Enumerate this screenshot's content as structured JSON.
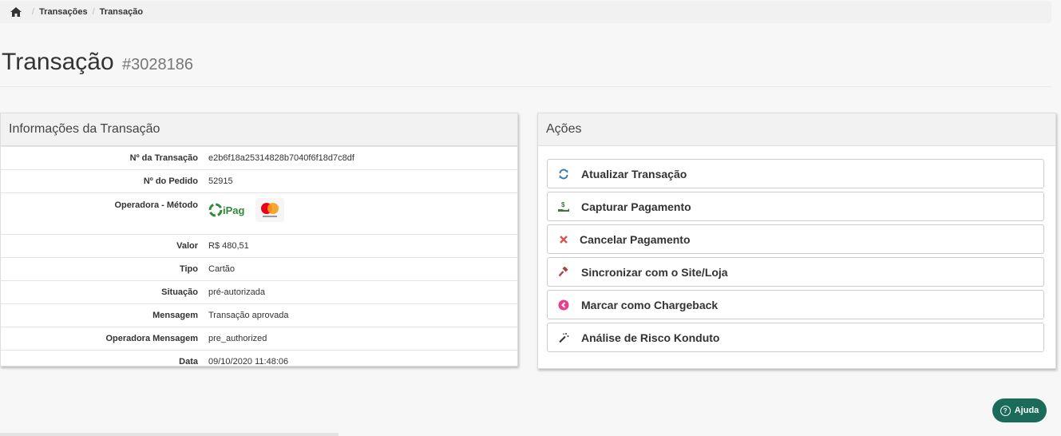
{
  "breadcrumb": {
    "home_icon": "home-icon",
    "items": [
      "Transações",
      "Transação"
    ]
  },
  "header": {
    "title": "Transação",
    "id": "#3028186"
  },
  "info_panel": {
    "title": "Informações da Transação",
    "rows": {
      "transaction_no": {
        "label": "Nº da Transação",
        "value": "e2b6f18a25314828b7040f6f18d7c8df"
      },
      "order_no": {
        "label": "Nº do Pedido",
        "value": "52915"
      },
      "operator_method": {
        "label": "Operadora - Método",
        "logos": [
          "iPag",
          "mastercard"
        ]
      },
      "amount": {
        "label": "Valor",
        "value": "R$ 480,51"
      },
      "type": {
        "label": "Tipo",
        "value": "Cartão"
      },
      "status": {
        "label": "Situação",
        "value": "pré-autorizada",
        "color": "#f0ad4e"
      },
      "message": {
        "label": "Mensagem",
        "value": "Transação aprovada"
      },
      "operator_message": {
        "label": "Operadora Mensagem",
        "value": "pre_authorized"
      },
      "date": {
        "label": "Data",
        "value": "09/10/2020 11:48:06"
      }
    }
  },
  "actions_panel": {
    "title": "Ações",
    "buttons": [
      {
        "label": "Atualizar Transação",
        "icon": "refresh-icon",
        "color": "#337ab7"
      },
      {
        "label": "Capturar Pagamento",
        "icon": "capture-money-icon",
        "color": "#3c763d"
      },
      {
        "label": "Cancelar Pagamento",
        "icon": "close-icon",
        "color": "#d9534f"
      },
      {
        "label": "Sincronizar com o Site/Loja",
        "icon": "gavel-icon",
        "color": "#a94442"
      },
      {
        "label": "Marcar como Chargeback",
        "icon": "chevron-circle-left-icon",
        "color": "#e83e8c"
      },
      {
        "label": "Análise de Risco Konduto",
        "icon": "magic-wand-icon",
        "color": "#333333"
      }
    ]
  },
  "help": {
    "label": "Ajuda",
    "icon": "question-circle-icon",
    "color": "#1b6b5b"
  }
}
